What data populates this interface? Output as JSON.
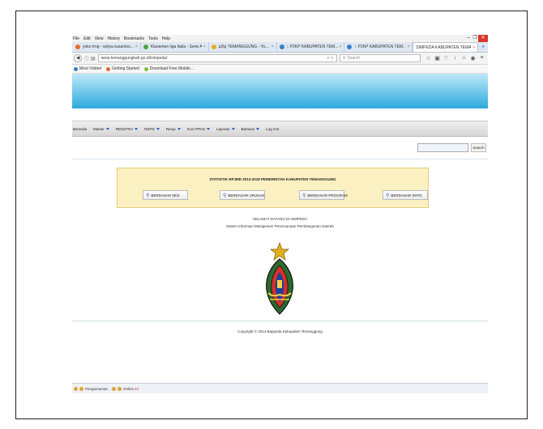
{
  "browser": {
    "menu": [
      "File",
      "Edit",
      "View",
      "History",
      "Bookmarks",
      "Tools",
      "Help"
    ],
    "window_buttons": [
      "‒",
      "❐",
      "✕"
    ],
    "tabs": [
      {
        "label": "yoko trng - setya.nusantoo...",
        "icon_color": "#e46b2e",
        "active": false
      },
      {
        "label": "Klasemen liga Italia - Serie A",
        "icon_color": "#49a63c",
        "active": false
      },
      {
        "label": "p2tp TEMANGGUNG - Yo...",
        "icon_color": "#e1b02a",
        "active": false
      },
      {
        "label": ":: P2KP KABUPATEN TEM...",
        "icon_color": "#3c7fc9",
        "active": false
      },
      {
        "label": ":: P2KP KABUPATEN TEM...",
        "icon_color": "#3c7fc9",
        "active": false
      },
      {
        "label": "SIMPEDA KABUPATEN TEMA...",
        "icon_color": "#ffffff",
        "active": true
      }
    ],
    "new_tab": "+",
    "url": "www.temanggungkab.go.id/simpeda/",
    "search_placeholder": "Search",
    "bookmarks": [
      {
        "label": "Most Visited",
        "icon_color": "#3c7fc9"
      },
      {
        "label": "Getting Started",
        "icon_color": "#e46b2e"
      },
      {
        "label": "Download Free Mobile...",
        "icon_color": "#7fbf3f"
      }
    ]
  },
  "site": {
    "nav": [
      {
        "label": "Beranda",
        "dropdown": false
      },
      {
        "label": "Master",
        "dropdown": true
      },
      {
        "label": "RENSTRA",
        "dropdown": true
      },
      {
        "label": "RKPD",
        "dropdown": true
      },
      {
        "label": "Renja",
        "dropdown": true
      },
      {
        "label": "KUA-PPAS",
        "dropdown": true
      },
      {
        "label": "Laporan",
        "dropdown": true
      },
      {
        "label": "Bantuan",
        "dropdown": true
      },
      {
        "label": "Log Out",
        "dropdown": false
      }
    ],
    "search_button": "Search",
    "panel_title": "STATISTIK RPJMD 2013-2018 PEMERINTAH KABUPATEN TEMANGGUNG",
    "panel_buttons": [
      "BERDASAR MISI",
      "BERDASAR URUSAN",
      "BERDASAR PROGRAM",
      "BERDASAR SKPD"
    ],
    "welcome_line1": "SELAMAT DATANG DI SIMPEDA",
    "welcome_line2": "Sistem Informasi Manajemen Perencanaan Pembangunan Daerah",
    "copyright": "Copyright © 2014 Bappeda Kabupaten Temanggung"
  },
  "statusbar": {
    "item1": "Pengumuman",
    "item2": "Online",
    "online_count": "24"
  }
}
